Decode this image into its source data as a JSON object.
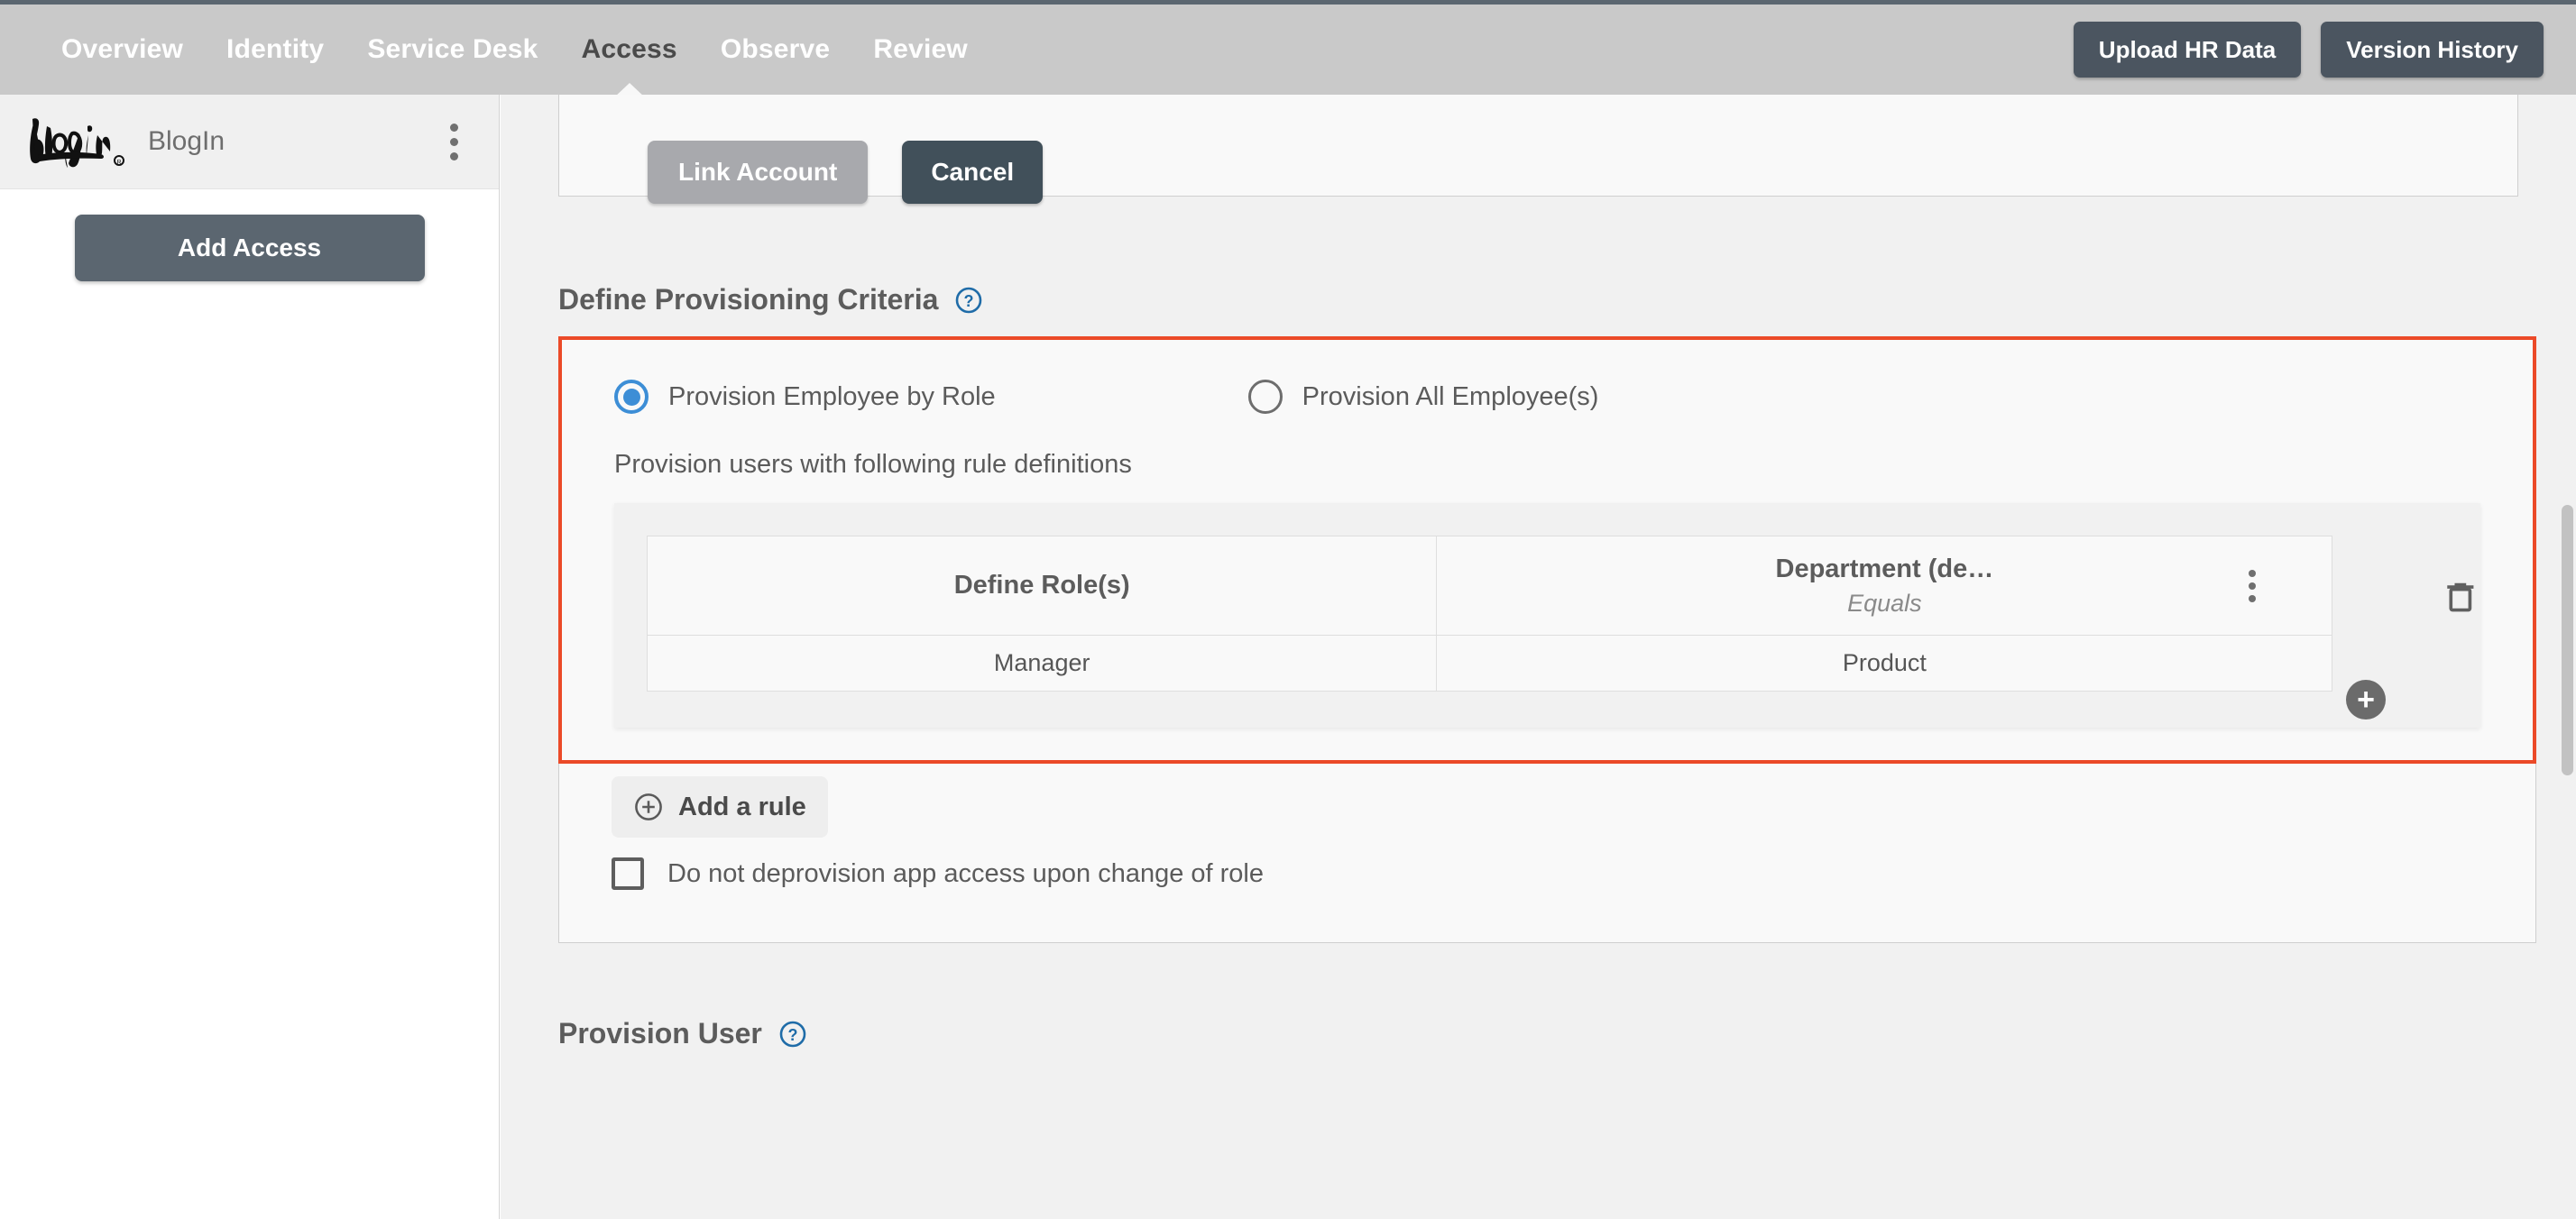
{
  "topbar": {
    "nav": [
      {
        "label": "Overview",
        "active": false
      },
      {
        "label": "Identity",
        "active": false
      },
      {
        "label": "Service Desk",
        "active": false
      },
      {
        "label": "Access",
        "active": true
      },
      {
        "label": "Observe",
        "active": false
      },
      {
        "label": "Review",
        "active": false
      }
    ],
    "upload_button": "Upload HR Data",
    "version_button": "Version History",
    "background_color": "#c9c9c9",
    "button_color": "#4b5560"
  },
  "sidebar": {
    "app_name": "BlogIn",
    "logo_icon": "blogin-logo",
    "menu_icon": "kebab-menu-icon",
    "add_access_button": "Add Access"
  },
  "main": {
    "link_account_button": "Link Account",
    "cancel_button": "Cancel",
    "provisioning": {
      "title": "Define Provisioning Criteria",
      "help_icon": "help-circle-icon",
      "highlight_color": "#eb4a28",
      "radio_options": [
        {
          "label": "Provision Employee by Role",
          "selected": true
        },
        {
          "label": "Provision All Employee(s)",
          "selected": false
        }
      ],
      "rule_intro": "Provision users with following rule definitions",
      "rule_table": {
        "columns": [
          {
            "title": "Define Role(s)",
            "operator": ""
          },
          {
            "title": "Department (de…",
            "operator": "Equals",
            "menu_icon": "kebab-menu-icon"
          }
        ],
        "rows": [
          [
            "Manager",
            "Product"
          ]
        ],
        "add_column_icon": "plus-circle-icon",
        "delete_icon": "trash-icon"
      },
      "add_rule_button": "Add a rule",
      "add_rule_icon": "plus-circle-outline-icon",
      "checkbox": {
        "label": "Do not deprovision app access upon change of role",
        "checked": false
      }
    },
    "provision_user": {
      "title": "Provision User",
      "help_icon": "help-circle-icon"
    }
  },
  "scrollbar": {
    "name": "vertical-scrollbar"
  }
}
